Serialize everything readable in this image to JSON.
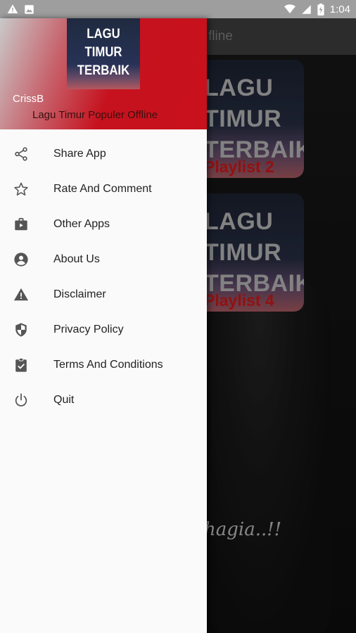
{
  "status_bar": {
    "time": "1:04"
  },
  "background": {
    "appbar_title_partial": "fline",
    "cards": [
      {
        "art_lines": [
          "LAGU",
          "TIMUR",
          "TERBAIK"
        ],
        "playlist": "Playlist 2"
      },
      {
        "art_lines": [
          "LAGU",
          "TIMUR",
          "TERBAIK"
        ],
        "playlist": "Playlist 4"
      }
    ],
    "caption_partial": "hagia..!!"
  },
  "drawer": {
    "logo_lines": [
      "LAGU",
      "TIMUR",
      "TERBAIK"
    ],
    "user_name": "CrissB",
    "app_subtitle": "Lagu Timur Populer Offline",
    "items": [
      {
        "label": "Share App",
        "icon": "share-icon"
      },
      {
        "label": "Rate And Comment",
        "icon": "star-outline-icon"
      },
      {
        "label": "Other Apps",
        "icon": "shop-bag-icon"
      },
      {
        "label": "About Us",
        "icon": "account-circle-icon"
      },
      {
        "label": "Disclaimer",
        "icon": "warning-icon"
      },
      {
        "label": "Privacy Policy",
        "icon": "shield-icon"
      },
      {
        "label": "Terms And Conditions",
        "icon": "clipboard-check-icon"
      },
      {
        "label": "Quit",
        "icon": "power-icon"
      }
    ]
  }
}
